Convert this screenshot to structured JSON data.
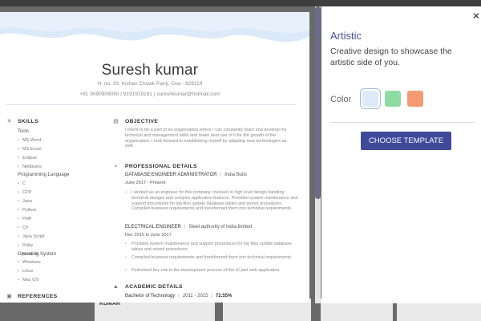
{
  "resume": {
    "name": "Suresh kumar",
    "address": "H. no. 33, Kishan Chowk Panji, Goa - 828119",
    "contact": "+91 9090909090 / 9191919191  |  sureshkumar@hotmail.com",
    "skills": {
      "heading": "SKILLS",
      "groups": [
        {
          "label": "Tools",
          "items": [
            "MS Word",
            "MS Excel",
            "Eclipse",
            "Netbeans"
          ]
        },
        {
          "label": "Programming Language",
          "items": [
            "C",
            "CPP",
            "Java",
            "Python",
            "PHP",
            "C#",
            "Java Script",
            "Ruby",
            "Node Js"
          ]
        },
        {
          "label": "Operating System",
          "items": [
            "Windows",
            "Linux",
            "Mac OS"
          ]
        }
      ]
    },
    "references_heading": "REFERENCES",
    "objective": {
      "heading": "OBJECTIVE",
      "text": "I intent to be a part of an organization where I can constantly learn and develop my technical and management skills and make best use of it for the growth of the organization. I look forward to establishing myself by adapting new technologies as well."
    },
    "professional": {
      "heading": "PROFESSIONAL DETAILS",
      "jobs": [
        {
          "title": "DATABASE ENGINEER ADMINISTRATOR",
          "company": "India Bulls",
          "dates": "June 2017 - Present",
          "bullets": [
            "I worked as an engineer for this company. Involved in high level design handling technical designs and complex application features. Provided system maintenance and support procedures for log files update database tables and stored procedures. Compiled business requirements and transformed them into technical requirements."
          ]
        },
        {
          "title": "ELECTRICAL ENGINEER",
          "company": "Steel authority of India limited",
          "dates": "Dec 2015 to June 2017",
          "bullets": [
            "Provided system maintenance and support procedures for log files update database tables and stored procedures.",
            "Compiled business requirements and transformed them into technical requirements.",
            "Performed key role in the development process of the UI part web application."
          ]
        }
      ]
    },
    "academic": {
      "heading": "ACADEMIC DETAILS",
      "degree": "Bachelor of Technology",
      "years": "2011 - 2015",
      "score": "72.55%"
    }
  },
  "background": {
    "peek_text_1": "KUMAR"
  },
  "panel": {
    "title": "Artistic",
    "description": "Creative design to showcase the artistic side of you.",
    "color_label": "Color",
    "swatches": [
      "#dfeaf8",
      "#8fdca3",
      "#f59b74"
    ],
    "button_label": "CHOOSE TEMPLATE",
    "close_glyph": "✕"
  }
}
